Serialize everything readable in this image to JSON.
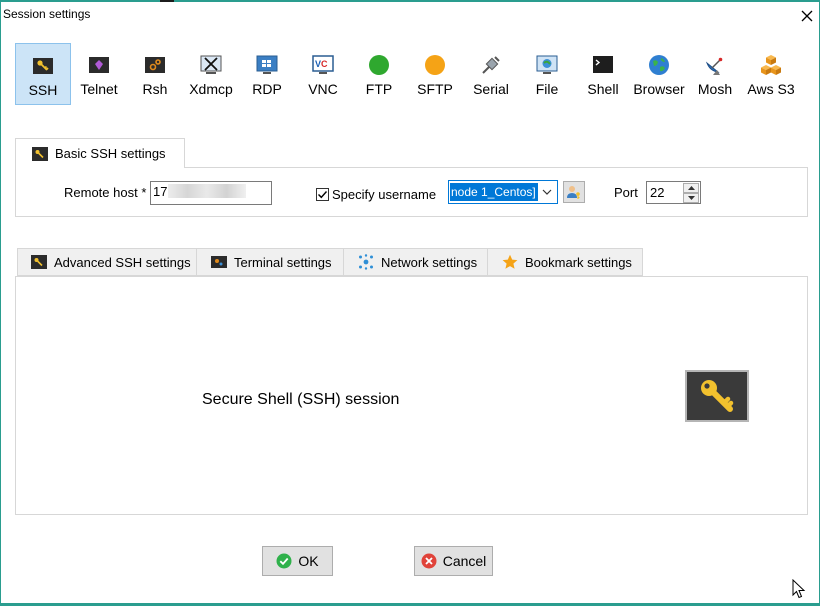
{
  "window": {
    "title": "Session settings"
  },
  "session_types": [
    {
      "label": "SSH",
      "icon": "ssh-key-icon",
      "selected": true
    },
    {
      "label": "Telnet",
      "icon": "telnet-icon"
    },
    {
      "label": "Rsh",
      "icon": "rsh-icon"
    },
    {
      "label": "Xdmcp",
      "icon": "xdmcp-icon"
    },
    {
      "label": "RDP",
      "icon": "rdp-monitor-icon"
    },
    {
      "label": "VNC",
      "icon": "vnc-icon"
    },
    {
      "label": "FTP",
      "icon": "ftp-green-circle-icon"
    },
    {
      "label": "SFTP",
      "icon": "sftp-orange-circle-icon"
    },
    {
      "label": "Serial",
      "icon": "serial-plug-icon"
    },
    {
      "label": "File",
      "icon": "file-computer-icon"
    },
    {
      "label": "Shell",
      "icon": "shell-terminal-icon"
    },
    {
      "label": "Browser",
      "icon": "globe-icon"
    },
    {
      "label": "Mosh",
      "icon": "satellite-dish-icon"
    },
    {
      "label": "Aws S3",
      "icon": "aws-s3-boxes-icon"
    }
  ],
  "basic": {
    "tab_label": "Basic SSH settings",
    "remote_host_label": "Remote host *",
    "remote_host_value": "17",
    "specify_username_label": "Specify username",
    "specify_username_checked": true,
    "username_value": "node 1_Centos]",
    "port_label": "Port",
    "port_value": "22"
  },
  "tabs": [
    {
      "label": "Advanced SSH settings",
      "icon": "key-icon"
    },
    {
      "label": "Terminal settings",
      "icon": "terminal-icon"
    },
    {
      "label": "Network settings",
      "icon": "network-icon"
    },
    {
      "label": "Bookmark settings",
      "icon": "star-icon"
    }
  ],
  "main": {
    "description": "Secure Shell (SSH) session"
  },
  "buttons": {
    "ok_label": "OK",
    "cancel_label": "Cancel"
  },
  "colors": {
    "accent": "#0078d7",
    "selected_bg": "#cce4f7",
    "frame": "#2a9d8f",
    "ok": "#2fb14b",
    "cancel": "#e0433a"
  }
}
